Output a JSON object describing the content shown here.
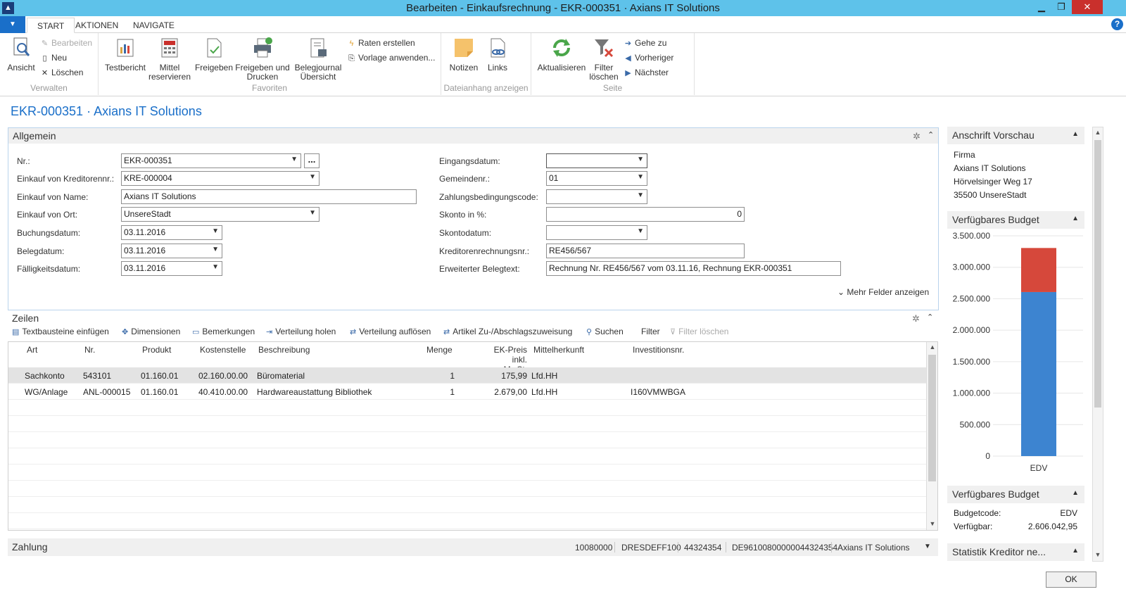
{
  "window": {
    "title": "Bearbeiten - Einkaufsrechnung - EKR-000351 · Axians IT Solutions",
    "logo": "▲",
    "minimize": "▁",
    "restore": "❐",
    "close": "✕"
  },
  "ribbon": {
    "menu_icon": "▼",
    "tabs": [
      "START",
      "AKTIONEN",
      "NAVIGATE"
    ],
    "help": "?",
    "groups": {
      "verwalten": {
        "label": "Verwalten",
        "ansicht": "Ansicht",
        "bearbeiten": "Bearbeiten",
        "neu": "Neu",
        "loeschen": "Löschen"
      },
      "favoriten": {
        "label": "Favoriten",
        "testbericht": "Testbericht",
        "mittel_1": "Mittel",
        "mittel_2": "reservieren",
        "freigeben": "Freigeben",
        "freigeben_drucken_1": "Freigeben und",
        "freigeben_drucken_2": "Drucken",
        "belegjournal_1": "Belegjournal",
        "belegjournal_2": "Übersicht",
        "raten": "Raten erstellen",
        "vorlage": "Vorlage anwenden..."
      },
      "dateianhang": {
        "label": "Dateianhang anzeigen",
        "notizen": "Notizen",
        "links": "Links"
      },
      "seite": {
        "label": "Seite",
        "aktualisieren": "Aktualisieren",
        "filter_1": "Filter",
        "filter_2": "löschen",
        "gehe_zu": "Gehe zu",
        "vorheriger": "Vorheriger",
        "naechster": "Nächster"
      }
    }
  },
  "page_title": "EKR-000351 · Axians IT Solutions",
  "allgemein": {
    "title": "Allgemein",
    "more_fields": "Mehr Felder anzeigen",
    "left": [
      {
        "label": "Nr.:",
        "value": "EKR-000351"
      },
      {
        "label": "Einkauf von Kreditorennr.:",
        "value": "KRE-000004"
      },
      {
        "label": "Einkauf von Name:",
        "value": "Axians IT Solutions"
      },
      {
        "label": "Einkauf von Ort:",
        "value": "UnsereStadt"
      },
      {
        "label": "Buchungsdatum:",
        "value": "03.11.2016"
      },
      {
        "label": "Belegdatum:",
        "value": "03.11.2016"
      },
      {
        "label": "Fälligkeitsdatum:",
        "value": "03.11.2016"
      }
    ],
    "right": [
      {
        "label": "Eingangsdatum:",
        "value": ""
      },
      {
        "label": "Gemeindenr.:",
        "value": "01"
      },
      {
        "label": "Zahlungsbedingungscode:",
        "value": ""
      },
      {
        "label": "Skonto in %:",
        "value": "0"
      },
      {
        "label": "Skontodatum:",
        "value": ""
      },
      {
        "label": "Kreditorenrechnungsnr.:",
        "value": "RE456/567"
      },
      {
        "label": "Erweiterter Belegtext:",
        "value": "Rechnung Nr. RE456/567 vom 03.11.16, Rechnung EKR-000351"
      }
    ],
    "assist": "..."
  },
  "zeilen": {
    "title": "Zeilen",
    "toolbar": [
      {
        "label": "Textbausteine einfügen",
        "icon": "▤"
      },
      {
        "label": "Dimensionen",
        "icon": "✥"
      },
      {
        "label": "Bemerkungen",
        "icon": "▭"
      },
      {
        "label": "Verteilung holen",
        "icon": "⇥"
      },
      {
        "label": "Verteilung auflösen",
        "icon": "⇄"
      },
      {
        "label": "Artikel Zu-/Abschlagszuweisung",
        "icon": "⇄"
      },
      {
        "label": "Suchen",
        "icon": "⚲"
      },
      {
        "label": "Filter",
        "icon": ""
      },
      {
        "label": "Filter löschen",
        "icon": "⊽"
      }
    ],
    "columns": [
      "Art",
      "Nr.",
      "Produkt",
      "Kostenstelle",
      "Beschreibung",
      "Menge",
      "EK-Preis inkl.",
      "MwSt.",
      "Mittelherkunft",
      "Investitionsnr."
    ],
    "rows": [
      {
        "art": "Sachkonto",
        "nr": "543101",
        "produkt": "01.160.01",
        "kostenstelle": "02.160.00.00",
        "beschreibung": "Büromaterial",
        "menge": "1",
        "preis": "175,99",
        "mittelherkunft": "Lfd.HH",
        "investitionsnr": ""
      },
      {
        "art": "WG/Anlage",
        "nr": "ANL-000015",
        "produkt": "01.160.01",
        "kostenstelle": "40.410.00.00",
        "beschreibung": "Hardwareaustattung Bibliothek",
        "menge": "1",
        "preis": "2.679,00",
        "mittelherkunft": "Lfd.HH",
        "investitionsnr": "I160VMWBGA"
      }
    ]
  },
  "zahlung": {
    "title": "Zahlung",
    "values": [
      "10080000",
      "DRESDEFF100",
      "44324354",
      "DE96100800000044324354",
      "Axians IT Solutions"
    ]
  },
  "factbox": {
    "anschrift": {
      "title": "Anschrift Vorschau",
      "lines": [
        "Firma",
        "Axians IT Solutions",
        "Hörvelsinger Weg 17",
        "35500 UnsereStadt"
      ]
    },
    "budget_chart_title": "Verfügbares Budget",
    "budget_info": {
      "title": "Verfügbares Budget",
      "budgetcode_label": "Budgetcode:",
      "budgetcode_value": "EDV",
      "verfuegbar_label": "Verfügbar:",
      "verfuegbar_value": "2.606.042,95"
    },
    "statistik_title": "Statistik Kreditor ne..."
  },
  "ok_button": "OK",
  "colors": {
    "accent": "#1a6fc9",
    "titlebar": "#5ec2ea",
    "bar_blue": "#3d84d0",
    "bar_red": "#d6483b"
  },
  "chart_data": {
    "type": "bar",
    "stacked": true,
    "categories": [
      "EDV"
    ],
    "series": [
      {
        "values": [
          2606042.95
        ],
        "color": "#3d84d0"
      },
      {
        "values": [
          700000
        ],
        "color": "#d6483b"
      }
    ],
    "ylim": [
      0,
      3500000
    ],
    "yticks": [
      "3.500.000",
      "3.000.000",
      "2.500.000",
      "2.000.000",
      "1.500.000",
      "1.000.000",
      "500.000",
      "0"
    ],
    "ytick_values": [
      3500000,
      3000000,
      2500000,
      2000000,
      1500000,
      1000000,
      500000,
      0
    ]
  }
}
